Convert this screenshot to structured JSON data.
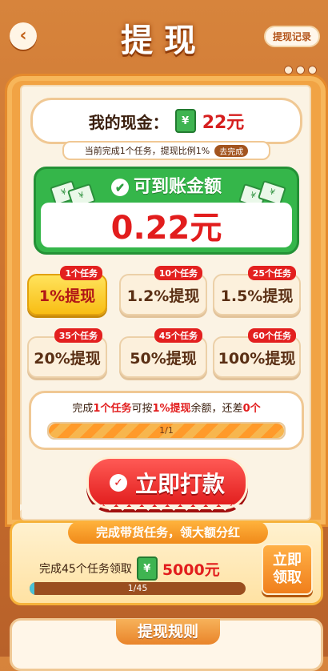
{
  "header": {
    "title": "提现",
    "back_icon": "back-arrow-icon",
    "record_label": "提现记录"
  },
  "cash": {
    "label": "我的现金：",
    "value": "22元",
    "icon": "money-icon"
  },
  "task_tip": {
    "text": "当前完成1个任务，提现比例1%",
    "button": "去完成"
  },
  "arrival": {
    "title": "可到账金额",
    "value": "0.22元"
  },
  "options": [
    {
      "badge": "1个任务",
      "label": "1%提现",
      "active": true
    },
    {
      "badge": "10个任务",
      "label": "1.2%提现",
      "active": false
    },
    {
      "badge": "25个任务",
      "label": "1.5%提现",
      "active": false
    },
    {
      "badge": "35个任务",
      "label": "20%提现",
      "active": false
    },
    {
      "badge": "45个任务",
      "label": "50%提现",
      "active": false
    },
    {
      "badge": "60个任务",
      "label": "100%提现",
      "active": false
    }
  ],
  "progress": {
    "text_prefix": "完成",
    "text_count": "1个任务",
    "text_mid": "可按",
    "text_pct": "1%提现",
    "text_suffix": "余额，还差",
    "text_remaining": "0个",
    "label": "1/1",
    "fraction": 1.0
  },
  "pay_button": {
    "label": "立即打款"
  },
  "bonus": {
    "title": "完成带货任务，领大额分红",
    "desc": "完成45个任务领取",
    "amount": "5000元",
    "claim_label": "立即领取",
    "progress_label": "1/45",
    "fraction": 0.022
  },
  "rules": {
    "title": "提现规则"
  },
  "colors": {
    "accent": "#e21d1d",
    "green": "#35b64a",
    "orange": "#f1a344"
  }
}
